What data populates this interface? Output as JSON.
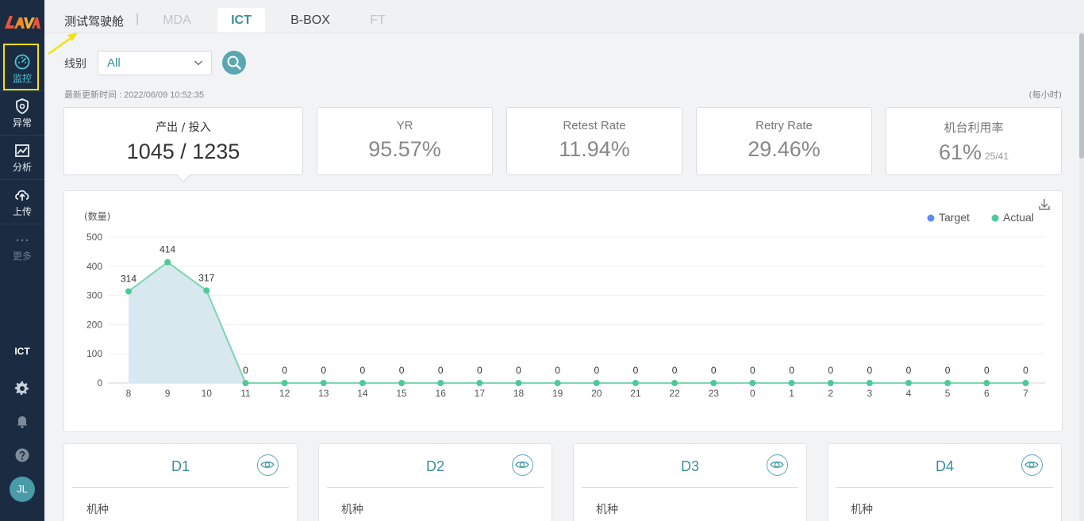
{
  "sidebar": {
    "logo_text": "LAVA",
    "items": [
      {
        "label": "监控",
        "icon": "dashboard-gauge-icon",
        "active": true
      },
      {
        "label": "异常",
        "icon": "shield-alert-icon"
      },
      {
        "label": "分析",
        "icon": "line-chart-icon"
      },
      {
        "label": "上传",
        "icon": "cloud-upload-icon"
      },
      {
        "label": "更多",
        "icon": "more-dots-icon"
      }
    ],
    "section_label": "ICT",
    "settings_icon": "gear-icon",
    "bell_icon": "bell-icon",
    "help_icon": "question-icon",
    "avatar_initials": "JL"
  },
  "header": {
    "app_title": "测试驾驶舱",
    "separator": "|",
    "tabs": [
      {
        "label": "MDA",
        "state": "disabled"
      },
      {
        "label": "ICT",
        "state": "active"
      },
      {
        "label": "B-BOX",
        "state": "normal"
      },
      {
        "label": "FT",
        "state": "disabled"
      }
    ]
  },
  "filter": {
    "label": "线别",
    "selected": "All"
  },
  "update_info": {
    "text": "最新更新时间 : 2022/06/09 10:52:35",
    "unit_note": "(每小时)"
  },
  "kpis": [
    {
      "label": "产出 / 投入",
      "value": "1045 / 1235",
      "sub": ""
    },
    {
      "label": "YR",
      "value": "95.57%",
      "sub": ""
    },
    {
      "label": "Retest Rate",
      "value": "11.94%",
      "sub": ""
    },
    {
      "label": "Retry Rate",
      "value": "29.46%",
      "sub": ""
    },
    {
      "label": "机台利用率",
      "value": "61%",
      "sub": "25/41"
    }
  ],
  "chart_data": {
    "type": "area",
    "ylabel": "(数量)",
    "ylim": [
      0,
      500
    ],
    "yticks": [
      0,
      100,
      200,
      300,
      400,
      500
    ],
    "categories": [
      "8",
      "9",
      "10",
      "11",
      "12",
      "13",
      "14",
      "15",
      "16",
      "17",
      "18",
      "19",
      "20",
      "21",
      "22",
      "23",
      "0",
      "1",
      "2",
      "3",
      "4",
      "5",
      "6",
      "7"
    ],
    "series": [
      {
        "name": "Target",
        "color": "#5b8def",
        "values": []
      },
      {
        "name": "Actual",
        "color": "#4ec99a",
        "values": [
          314,
          414,
          317,
          0,
          0,
          0,
          0,
          0,
          0,
          0,
          0,
          0,
          0,
          0,
          0,
          0,
          0,
          0,
          0,
          0,
          0,
          0,
          0,
          0
        ]
      }
    ],
    "legend_position": "top-right",
    "grid": true
  },
  "departments": [
    {
      "title": "D1",
      "field_label": "机种"
    },
    {
      "title": "D2",
      "field_label": "机种"
    },
    {
      "title": "D3",
      "field_label": "机种"
    },
    {
      "title": "D4",
      "field_label": "机种"
    }
  ]
}
